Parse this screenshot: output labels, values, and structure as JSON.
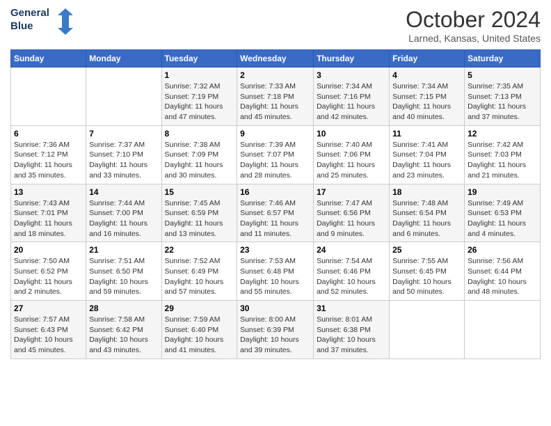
{
  "header": {
    "logo_line1": "General",
    "logo_line2": "Blue",
    "month": "October 2024",
    "location": "Larned, Kansas, United States"
  },
  "days_of_week": [
    "Sunday",
    "Monday",
    "Tuesday",
    "Wednesday",
    "Thursday",
    "Friday",
    "Saturday"
  ],
  "weeks": [
    [
      {
        "day": "",
        "sunrise": "",
        "sunset": "",
        "daylight": ""
      },
      {
        "day": "",
        "sunrise": "",
        "sunset": "",
        "daylight": ""
      },
      {
        "day": "1",
        "sunrise": "Sunrise: 7:32 AM",
        "sunset": "Sunset: 7:19 PM",
        "daylight": "Daylight: 11 hours and 47 minutes."
      },
      {
        "day": "2",
        "sunrise": "Sunrise: 7:33 AM",
        "sunset": "Sunset: 7:18 PM",
        "daylight": "Daylight: 11 hours and 45 minutes."
      },
      {
        "day": "3",
        "sunrise": "Sunrise: 7:34 AM",
        "sunset": "Sunset: 7:16 PM",
        "daylight": "Daylight: 11 hours and 42 minutes."
      },
      {
        "day": "4",
        "sunrise": "Sunrise: 7:34 AM",
        "sunset": "Sunset: 7:15 PM",
        "daylight": "Daylight: 11 hours and 40 minutes."
      },
      {
        "day": "5",
        "sunrise": "Sunrise: 7:35 AM",
        "sunset": "Sunset: 7:13 PM",
        "daylight": "Daylight: 11 hours and 37 minutes."
      }
    ],
    [
      {
        "day": "6",
        "sunrise": "Sunrise: 7:36 AM",
        "sunset": "Sunset: 7:12 PM",
        "daylight": "Daylight: 11 hours and 35 minutes."
      },
      {
        "day": "7",
        "sunrise": "Sunrise: 7:37 AM",
        "sunset": "Sunset: 7:10 PM",
        "daylight": "Daylight: 11 hours and 33 minutes."
      },
      {
        "day": "8",
        "sunrise": "Sunrise: 7:38 AM",
        "sunset": "Sunset: 7:09 PM",
        "daylight": "Daylight: 11 hours and 30 minutes."
      },
      {
        "day": "9",
        "sunrise": "Sunrise: 7:39 AM",
        "sunset": "Sunset: 7:07 PM",
        "daylight": "Daylight: 11 hours and 28 minutes."
      },
      {
        "day": "10",
        "sunrise": "Sunrise: 7:40 AM",
        "sunset": "Sunset: 7:06 PM",
        "daylight": "Daylight: 11 hours and 25 minutes."
      },
      {
        "day": "11",
        "sunrise": "Sunrise: 7:41 AM",
        "sunset": "Sunset: 7:04 PM",
        "daylight": "Daylight: 11 hours and 23 minutes."
      },
      {
        "day": "12",
        "sunrise": "Sunrise: 7:42 AM",
        "sunset": "Sunset: 7:03 PM",
        "daylight": "Daylight: 11 hours and 21 minutes."
      }
    ],
    [
      {
        "day": "13",
        "sunrise": "Sunrise: 7:43 AM",
        "sunset": "Sunset: 7:01 PM",
        "daylight": "Daylight: 11 hours and 18 minutes."
      },
      {
        "day": "14",
        "sunrise": "Sunrise: 7:44 AM",
        "sunset": "Sunset: 7:00 PM",
        "daylight": "Daylight: 11 hours and 16 minutes."
      },
      {
        "day": "15",
        "sunrise": "Sunrise: 7:45 AM",
        "sunset": "Sunset: 6:59 PM",
        "daylight": "Daylight: 11 hours and 13 minutes."
      },
      {
        "day": "16",
        "sunrise": "Sunrise: 7:46 AM",
        "sunset": "Sunset: 6:57 PM",
        "daylight": "Daylight: 11 hours and 11 minutes."
      },
      {
        "day": "17",
        "sunrise": "Sunrise: 7:47 AM",
        "sunset": "Sunset: 6:56 PM",
        "daylight": "Daylight: 11 hours and 9 minutes."
      },
      {
        "day": "18",
        "sunrise": "Sunrise: 7:48 AM",
        "sunset": "Sunset: 6:54 PM",
        "daylight": "Daylight: 11 hours and 6 minutes."
      },
      {
        "day": "19",
        "sunrise": "Sunrise: 7:49 AM",
        "sunset": "Sunset: 6:53 PM",
        "daylight": "Daylight: 11 hours and 4 minutes."
      }
    ],
    [
      {
        "day": "20",
        "sunrise": "Sunrise: 7:50 AM",
        "sunset": "Sunset: 6:52 PM",
        "daylight": "Daylight: 11 hours and 2 minutes."
      },
      {
        "day": "21",
        "sunrise": "Sunrise: 7:51 AM",
        "sunset": "Sunset: 6:50 PM",
        "daylight": "Daylight: 10 hours and 59 minutes."
      },
      {
        "day": "22",
        "sunrise": "Sunrise: 7:52 AM",
        "sunset": "Sunset: 6:49 PM",
        "daylight": "Daylight: 10 hours and 57 minutes."
      },
      {
        "day": "23",
        "sunrise": "Sunrise: 7:53 AM",
        "sunset": "Sunset: 6:48 PM",
        "daylight": "Daylight: 10 hours and 55 minutes."
      },
      {
        "day": "24",
        "sunrise": "Sunrise: 7:54 AM",
        "sunset": "Sunset: 6:46 PM",
        "daylight": "Daylight: 10 hours and 52 minutes."
      },
      {
        "day": "25",
        "sunrise": "Sunrise: 7:55 AM",
        "sunset": "Sunset: 6:45 PM",
        "daylight": "Daylight: 10 hours and 50 minutes."
      },
      {
        "day": "26",
        "sunrise": "Sunrise: 7:56 AM",
        "sunset": "Sunset: 6:44 PM",
        "daylight": "Daylight: 10 hours and 48 minutes."
      }
    ],
    [
      {
        "day": "27",
        "sunrise": "Sunrise: 7:57 AM",
        "sunset": "Sunset: 6:43 PM",
        "daylight": "Daylight: 10 hours and 45 minutes."
      },
      {
        "day": "28",
        "sunrise": "Sunrise: 7:58 AM",
        "sunset": "Sunset: 6:42 PM",
        "daylight": "Daylight: 10 hours and 43 minutes."
      },
      {
        "day": "29",
        "sunrise": "Sunrise: 7:59 AM",
        "sunset": "Sunset: 6:40 PM",
        "daylight": "Daylight: 10 hours and 41 minutes."
      },
      {
        "day": "30",
        "sunrise": "Sunrise: 8:00 AM",
        "sunset": "Sunset: 6:39 PM",
        "daylight": "Daylight: 10 hours and 39 minutes."
      },
      {
        "day": "31",
        "sunrise": "Sunrise: 8:01 AM",
        "sunset": "Sunset: 6:38 PM",
        "daylight": "Daylight: 10 hours and 37 minutes."
      },
      {
        "day": "",
        "sunrise": "",
        "sunset": "",
        "daylight": ""
      },
      {
        "day": "",
        "sunrise": "",
        "sunset": "",
        "daylight": ""
      }
    ]
  ]
}
